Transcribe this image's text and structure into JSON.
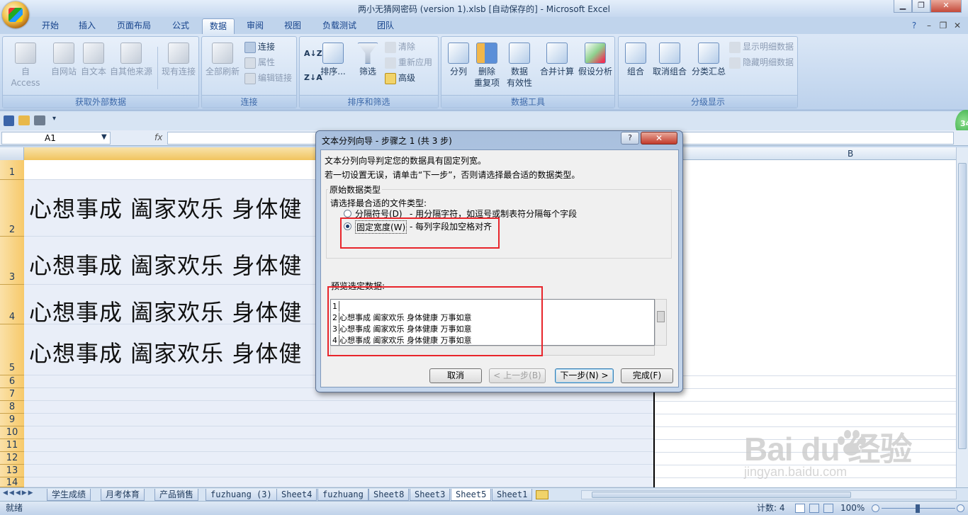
{
  "window": {
    "title": "两小无猜网密码 (version 1).xlsb [自动保存的] - Microsoft Excel",
    "minimize": "▁",
    "restore": "❐",
    "close": "✕",
    "ribbon_help": "?",
    "ribbon_min": "–",
    "ribbon_restore": "❐",
    "ribbon_close": "✕"
  },
  "tabs": [
    "开始",
    "插入",
    "页面布局",
    "公式",
    "数据",
    "审阅",
    "视图",
    "负载测试",
    "团队"
  ],
  "active_tab": "数据",
  "ribbon": {
    "get_external": {
      "label": "获取外部数据",
      "buttons": [
        "自 Access",
        "自网站",
        "自文本",
        "自其他来源",
        "现有连接"
      ]
    },
    "connections": {
      "label": "连接",
      "refresh_all": "全部刷新",
      "small": [
        "连接",
        "属性",
        "编辑链接"
      ]
    },
    "sort_filter": {
      "label": "排序和筛选",
      "sort": "排序...",
      "filter": "筛选",
      "small": [
        "清除",
        "重新应用",
        "高级"
      ]
    },
    "data_tools": {
      "label": "数据工具",
      "buttons": [
        "分列",
        "删除\n重复项",
        "数据\n有效性",
        "合并计算",
        "假设分析"
      ]
    },
    "outline": {
      "label": "分级显示",
      "buttons": [
        "组合",
        "取消组合",
        "分类汇总"
      ],
      "small": [
        "显示明细数据",
        "隐藏明细数据"
      ]
    }
  },
  "qat": {
    "more": "▾"
  },
  "formula_bar": {
    "name_box": "A1",
    "fx": "fx",
    "formula": ""
  },
  "sheet": {
    "col_b": "B",
    "rows": [
      "1",
      "2",
      "3",
      "4",
      "5",
      "6",
      "7",
      "8",
      "9",
      "10",
      "11",
      "12",
      "13",
      "14"
    ],
    "cell_texts": [
      "心想事成  阖家欢乐  身体健",
      "心想事成  阖家欢乐  身体健",
      "心想事成  阖家欢乐  身体健",
      "心想事成  阖家欢乐  身体健"
    ]
  },
  "sheet_tabs": [
    "学生成绩",
    "月考体育",
    "产品销售",
    "fuzhuang (3)",
    "Sheet4",
    "fuzhuang",
    "Sheet8",
    "Sheet3",
    "Sheet5",
    "Sheet1"
  ],
  "active_sheet": "Sheet5",
  "status": {
    "ready": "就绪",
    "count": "计数: 4",
    "zoom": "100%"
  },
  "dialog": {
    "title": "文本分列向导 - 步骤之 1 (共 3 步)",
    "help": "?",
    "close": "✕",
    "line1": "文本分列向导判定您的数据具有固定列宽。",
    "line2": "若一切设置无误，请单击“下一步”，否则请选择最合适的数据类型。",
    "group_title": "原始数据类型",
    "choose_label": "请选择最合适的文件类型:",
    "option_delimited": "分隔符号(D)",
    "option_delimited_desc": "- 用分隔字符，如逗号或制表符分隔每个字段",
    "option_fixed": "固定宽度(W)",
    "option_fixed_desc": "- 每列字段加空格对齐",
    "selected_option": "fixed",
    "preview_label": "预览选定数据:",
    "preview_rows": [
      {
        "num": "1",
        "text": ""
      },
      {
        "num": "2",
        "text": "心想事成 阖家欢乐 身体健康 万事如意"
      },
      {
        "num": "3",
        "text": "心想事成 阖家欢乐 身体健康 万事如意"
      },
      {
        "num": "4",
        "text": "心想事成 阖家欢乐 身体健康 万事如意"
      }
    ],
    "buttons": {
      "cancel": "取消",
      "back": "< 上一步(B)",
      "next": "下一步(N) >",
      "finish": "完成(F)"
    }
  },
  "watermark": {
    "brand": "Bai du 经验",
    "site": "jingyan.baidu.com"
  },
  "badge": "34"
}
